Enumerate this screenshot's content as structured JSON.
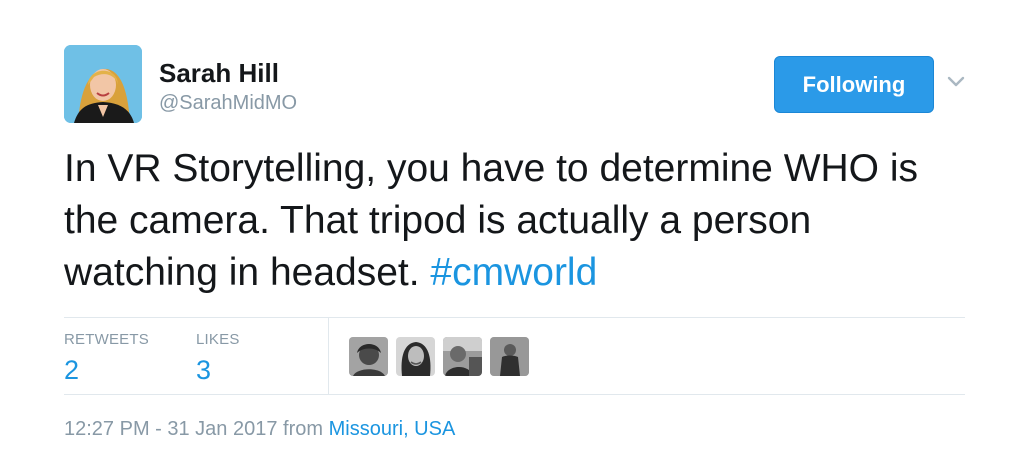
{
  "author": {
    "name": "Sarah Hill",
    "handle": "@SarahMidMO",
    "avatar_icon": "profile-photo"
  },
  "follow_button": {
    "label": "Following",
    "color": "#2b9ae8"
  },
  "menu_icon": "chevron-down-icon",
  "tweet": {
    "text": "In VR Storytelling, you have to determine WHO is\nthe camera. That tripod is actually a person\nwatching in headset. ",
    "hashtag": "#cmworld",
    "link_color": "#1b95e0"
  },
  "stats": {
    "retweets_label": "RETWEETS",
    "retweets_value": "2",
    "likes_label": "LIKES",
    "likes_value": "3"
  },
  "likers": [
    "liker-avatar-1",
    "liker-avatar-2",
    "liker-avatar-3",
    "liker-avatar-4"
  ],
  "footer": {
    "timestamp": "12:27 PM - 31 Jan 2017",
    "from_text": " from ",
    "location": "Missouri, USA"
  }
}
